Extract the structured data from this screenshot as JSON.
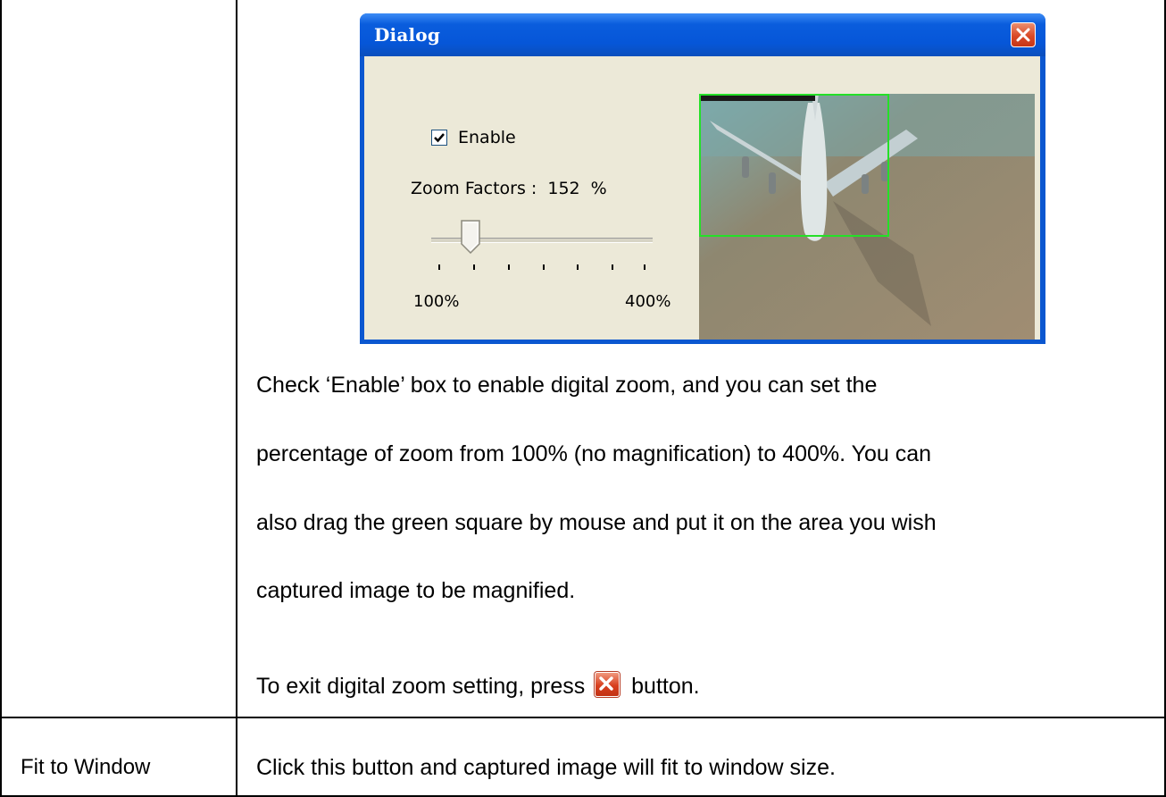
{
  "dialog": {
    "title": "Dialog",
    "enable_label": "Enable",
    "enable_checked": true,
    "zoom_factors_label": "Zoom Factors :",
    "zoom_value": "152",
    "zoom_unit": "%",
    "slider_min_label": "100%",
    "slider_max_label": "400%",
    "slider_min": 100,
    "slider_max": 400,
    "slider_value": 152,
    "preview_icon": "airplane-preview-image",
    "zoom_region_color": "#24e028"
  },
  "description": {
    "line1": "Check ‘Enable’ box to enable digital zoom, and you can set the",
    "line2": "percentage of zoom from 100% (no magnification) to 400%. You can",
    "line3": "also drag the green square by mouse and put it on the area you wish",
    "line4": "captured image to be magnified.",
    "exit_before": "To exit digital zoom setting, press",
    "exit_after": "button.",
    "exit_icon": "close-icon"
  },
  "rows": [
    {
      "label": "Fit to Window",
      "text": "Click this button and captured image will fit to window size."
    }
  ]
}
